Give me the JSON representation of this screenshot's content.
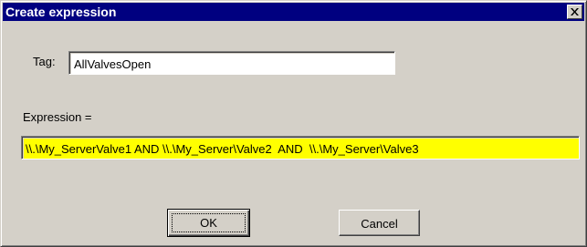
{
  "dialog": {
    "title": "Create expression",
    "close_icon": "close-x-icon"
  },
  "form": {
    "tag_label": "Tag:",
    "tag_value": "AllValvesOpen",
    "expression_label": "Expression =",
    "expression_value": "\\\\.\\My_ServerValve1 AND \\\\.\\My_Server\\Valve2  AND  \\\\.\\My_Server\\Valve3",
    "expression_highlight_color": "#ffff00"
  },
  "buttons": {
    "ok_label": "OK",
    "cancel_label": "Cancel"
  },
  "colors": {
    "titlebar": "#000080",
    "face": "#d4d0c8"
  }
}
